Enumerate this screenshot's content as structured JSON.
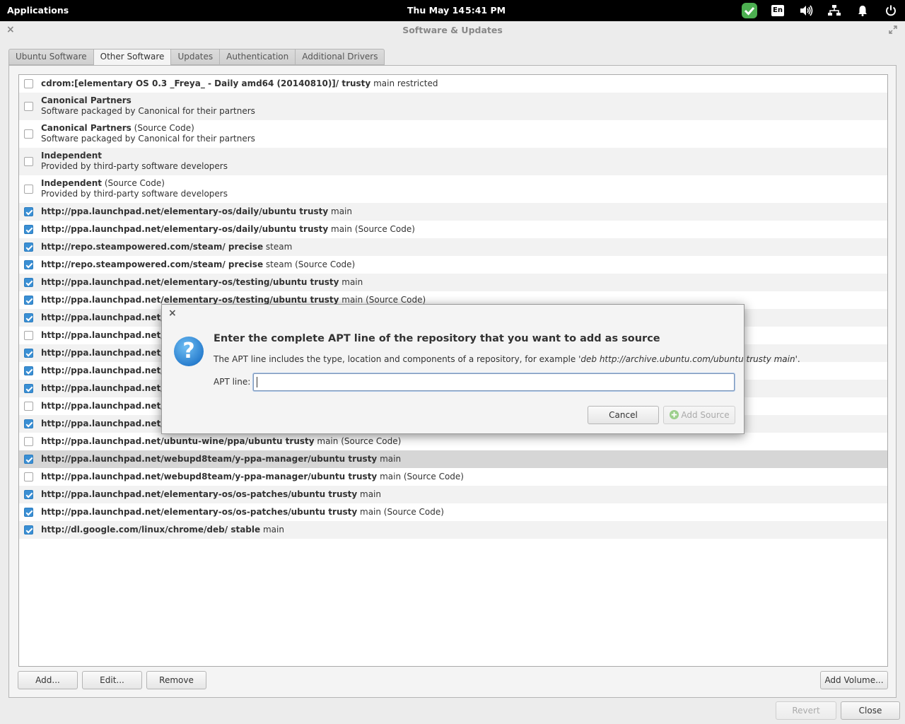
{
  "panel": {
    "applications": "Applications",
    "date": "Thu May 14",
    "time": "5:41 PM",
    "keyboard": "En",
    "icons": [
      "shield-check-icon",
      "keyboard-layout-icon",
      "volume-icon",
      "network-icon",
      "notification-bell-icon",
      "power-icon"
    ]
  },
  "window": {
    "title": "Software & Updates"
  },
  "tabs": [
    "Ubuntu Software",
    "Other Software",
    "Updates",
    "Authentication",
    "Additional Drivers"
  ],
  "active_tab": "Other Software",
  "sources": [
    {
      "checked": false,
      "bold": "cdrom:[elementary OS 0.3 _Freya_ - Daily amd64 (20140810)]/ trusty",
      "rest": " main restricted",
      "sub": ""
    },
    {
      "checked": false,
      "bold": "Canonical Partners",
      "rest": "",
      "sub": "Software packaged by Canonical for their partners"
    },
    {
      "checked": false,
      "bold": "Canonical Partners",
      "rest": " (Source Code)",
      "sub": "Software packaged by Canonical for their partners"
    },
    {
      "checked": false,
      "bold": "Independent",
      "rest": "",
      "sub": "Provided by third-party software developers"
    },
    {
      "checked": false,
      "bold": "Independent",
      "rest": " (Source Code)",
      "sub": "Provided by third-party software developers"
    },
    {
      "checked": true,
      "bold": "http://ppa.launchpad.net/elementary-os/daily/ubuntu trusty",
      "rest": " main",
      "sub": ""
    },
    {
      "checked": true,
      "bold": "http://ppa.launchpad.net/elementary-os/daily/ubuntu trusty",
      "rest": " main (Source Code)",
      "sub": ""
    },
    {
      "checked": true,
      "bold": "http://repo.steampowered.com/steam/ precise",
      "rest": " steam",
      "sub": ""
    },
    {
      "checked": true,
      "bold": "http://repo.steampowered.com/steam/ precise",
      "rest": " steam (Source Code)",
      "sub": ""
    },
    {
      "checked": true,
      "bold": "http://ppa.launchpad.net/elementary-os/testing/ubuntu trusty",
      "rest": " main",
      "sub": ""
    },
    {
      "checked": true,
      "bold": "http://ppa.launchpad.net/elementary-os/testing/ubuntu trusty",
      "rest": " main (Source Code)",
      "sub": ""
    },
    {
      "checked": true,
      "bold": "http://ppa.launchpad.net/ste",
      "rest": "",
      "sub": ""
    },
    {
      "checked": false,
      "bold": "http://ppa.launchpad.net/ste",
      "rest": "",
      "sub": ""
    },
    {
      "checked": true,
      "bold": "http://ppa.launchpad.net/vala",
      "rest": "",
      "sub": ""
    },
    {
      "checked": true,
      "bold": "http://ppa.launchpad.net/vala",
      "rest": "",
      "sub": ""
    },
    {
      "checked": true,
      "bold": "http://ppa.launchpad.net/saia",
      "rest": "",
      "sub": ""
    },
    {
      "checked": false,
      "bold": "http://ppa.launchpad.net/saia",
      "rest": "",
      "sub": ""
    },
    {
      "checked": true,
      "bold": "http://ppa.launchpad.net/ubu",
      "rest": "",
      "sub": ""
    },
    {
      "checked": false,
      "bold": "http://ppa.launchpad.net/ubuntu-wine/ppa/ubuntu trusty",
      "rest": " main (Source Code)",
      "sub": ""
    },
    {
      "checked": true,
      "bold": "http://ppa.launchpad.net/webupd8team/y-ppa-manager/ubuntu trusty",
      "rest": " main",
      "sub": "",
      "selected": true
    },
    {
      "checked": false,
      "bold": "http://ppa.launchpad.net/webupd8team/y-ppa-manager/ubuntu trusty",
      "rest": " main (Source Code)",
      "sub": ""
    },
    {
      "checked": true,
      "bold": "http://ppa.launchpad.net/elementary-os/os-patches/ubuntu trusty",
      "rest": " main",
      "sub": ""
    },
    {
      "checked": true,
      "bold": "http://ppa.launchpad.net/elementary-os/os-patches/ubuntu trusty",
      "rest": " main (Source Code)",
      "sub": ""
    },
    {
      "checked": true,
      "bold": "http://dl.google.com/linux/chrome/deb/ stable",
      "rest": " main",
      "sub": ""
    }
  ],
  "buttons": {
    "add": "Add...",
    "edit": "Edit...",
    "remove": "Remove",
    "add_volume": "Add Volume...",
    "revert": "Revert",
    "close": "Close"
  },
  "dialog": {
    "heading": "Enter the complete APT line of the repository that you want to add as source",
    "desc_prefix": "The APT line includes the type, location and components of a repository, for example  '",
    "desc_example": "deb http://archive.ubuntu.com/ubuntu trusty main",
    "desc_suffix": "'.",
    "apt_label": "APT line:",
    "apt_value": "",
    "cancel": "Cancel",
    "add_source": "Add Source",
    "icon": "question-icon"
  }
}
